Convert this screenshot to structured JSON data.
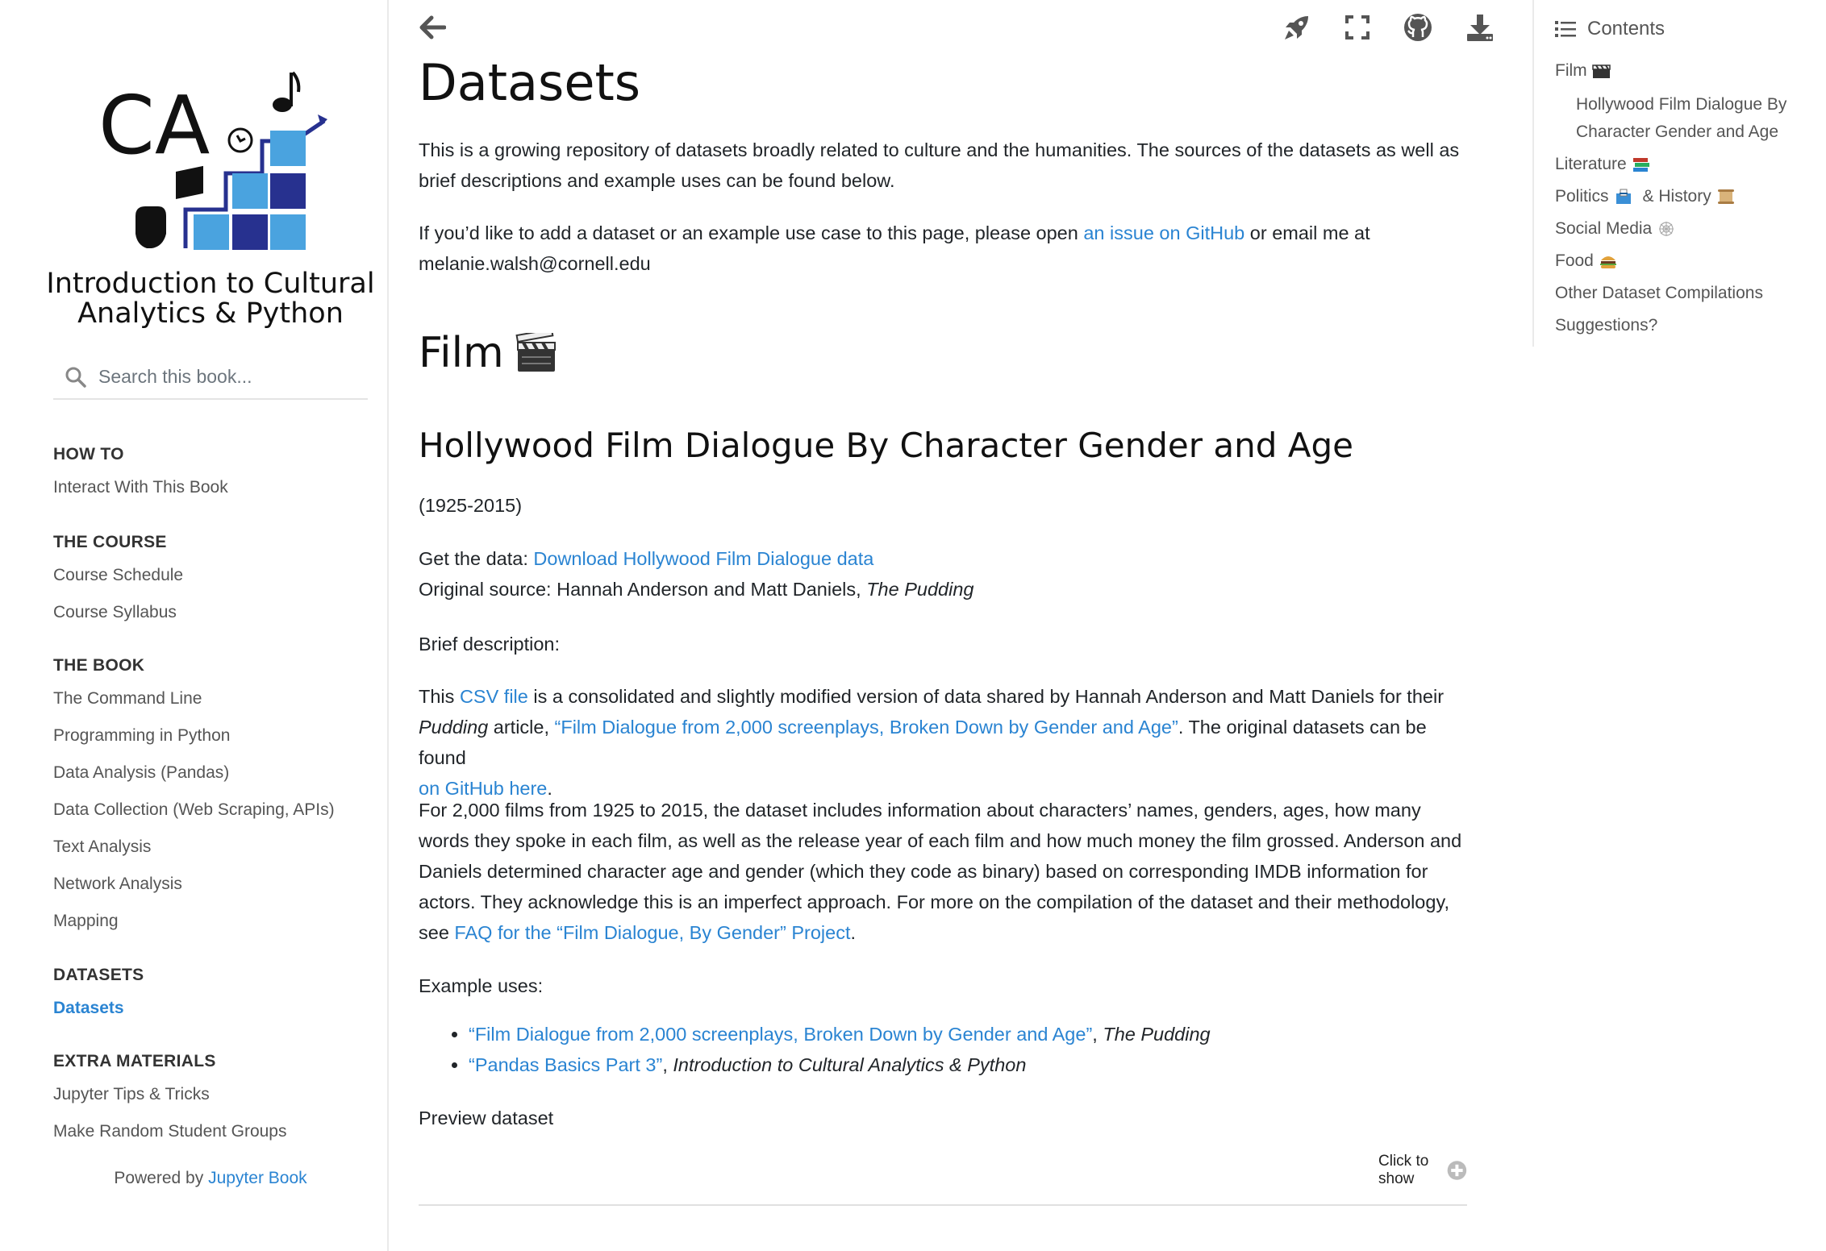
{
  "sidebar": {
    "logo_text": "CA",
    "book_title_line1": "Introduction to Cultural",
    "book_title_line2": "Analytics & Python",
    "search_placeholder": "Search this book...",
    "sections": [
      {
        "caption": "HOW TO",
        "items": [
          "Interact With This Book"
        ]
      },
      {
        "caption": "THE COURSE",
        "items": [
          "Course Schedule",
          "Course Syllabus"
        ]
      },
      {
        "caption": "THE BOOK",
        "items": [
          "The Command Line",
          "Programming in Python",
          "Data Analysis (Pandas)",
          "Data Collection (Web Scraping, APIs)",
          "Text Analysis",
          "Network Analysis",
          "Mapping"
        ]
      },
      {
        "caption": "DATASETS",
        "items": [
          "Datasets"
        ]
      },
      {
        "caption": "EXTRA MATERIALS",
        "items": [
          "Jupyter Tips & Tricks",
          "Make Random Student Groups"
        ]
      }
    ],
    "powered_by": "Powered by",
    "powered_link": "Jupyter Book"
  },
  "topbar": {
    "icons": [
      "back-arrow-icon",
      "rocket-icon",
      "fullscreen-icon",
      "github-icon",
      "download-icon"
    ]
  },
  "main": {
    "title": "Datasets",
    "intro_1": "This is a growing repository of datasets broadly related to culture and the humanities. The sources of the datasets as well as brief descriptions and example uses can be found below.",
    "intro_2_a": "If you’d like to add a dataset or an example use case to this page, please open ",
    "intro_2_link": "an issue on GitHub",
    "intro_2_b": " or email me at",
    "intro_2_email": "melanie.walsh@cornell.edu",
    "film_heading": "Film",
    "section_heading": "Hollywood Film Dialogue By Character Gender and Age",
    "years": "(1925-2015)",
    "get_data_label": "Get the data: ",
    "get_data_link": "Download Hollywood Film Dialogue data",
    "source_label": "Original source: Hannah Anderson and Matt Daniels, ",
    "source_pub": "The Pudding",
    "brief_label": "Brief description:",
    "desc_this": "This ",
    "desc_csv_link": "CSV file",
    "desc_a": " is a consolidated and slightly modified version of data shared by Hannah Anderson and Matt Daniels for their",
    "desc_pudding": "Pudding",
    "desc_article": " article, ",
    "desc_article_link": "“Film Dialogue from 2,000 screenplays, Broken Down by Gender and Age”",
    "desc_b": ". The original datasets can be found",
    "desc_github_link": "on GitHub here",
    "desc_period": ".",
    "para_line1": "For 2,000 films from 1925 to 2015, the dataset includes information about characters’ names, genders, ages, how many",
    "para_line2": "words they spoke in each film, as well as the release year of each film and how much money the film grossed. Anderson and",
    "para_line3": "Daniels determined character age and gender (which they code as binary) based on corresponding IMDB information for",
    "para_line4": "actors. They acknowledge this is an imperfect approach. For more on the compilation of the dataset and their methodology,",
    "para_see": "see ",
    "para_faq_link": "FAQ for the “Film Dialogue, By Gender” Project",
    "para_period": ".",
    "example_label": "Example uses:",
    "examples": [
      {
        "link": "“Film Dialogue from 2,000 screenplays, Broken Down by Gender and Age”",
        "sep": ", ",
        "source": "The Pudding"
      },
      {
        "link": "“Pandas Basics Part 3”",
        "sep": ", ",
        "source": "Introduction to Cultural Analytics & Python"
      }
    ],
    "preview_label": "Preview dataset",
    "click_to_show": "Click to show"
  },
  "toc": {
    "header": "Contents",
    "items": [
      "Film",
      "Hollywood Film Dialogue By",
      "Character Gender and Age",
      "Literature",
      "Politics",
      "& History",
      "Social Media",
      "Food",
      "Other Dataset Compilations",
      "Suggestions?"
    ]
  },
  "colors": {
    "link": "#2a84d2",
    "logo_dark_blue": "#27318f",
    "logo_light_blue": "#4aa3df"
  }
}
